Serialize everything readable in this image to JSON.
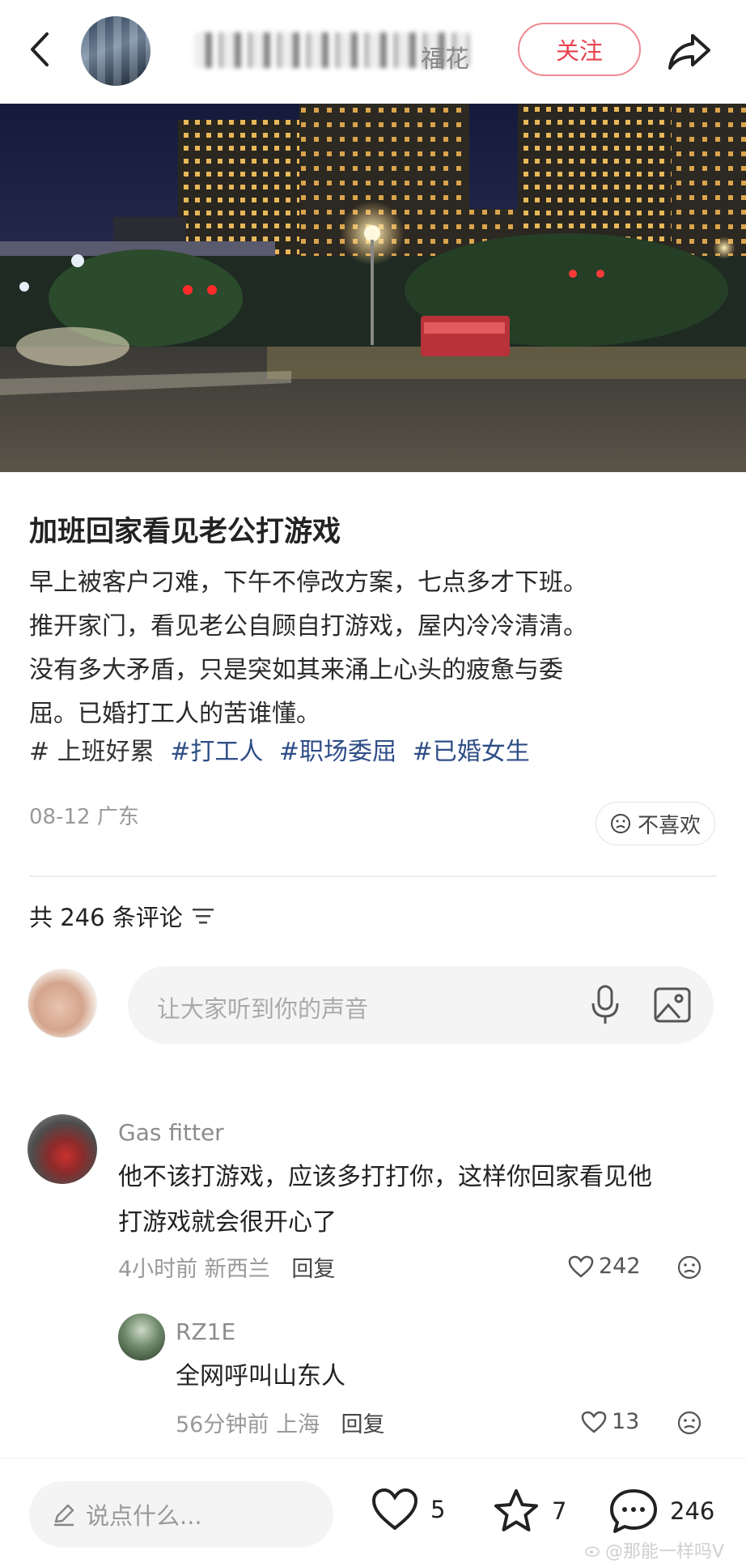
{
  "header": {
    "author_name_visible": "福花",
    "follow_label": "关注"
  },
  "post": {
    "title": "加班回家看见老公打游戏",
    "body_lines": [
      "早上被客户刁难，下午不停改方案，七点多才下班。",
      "推开家门，看见老公自顾自打游戏，屋内冷冷清清。",
      "没有多大矛盾，只是突如其来涌上心头的疲惫与委",
      "屈。已婚打工人的苦谁懂。"
    ],
    "tags": [
      "# 上班好累",
      "#打工人",
      "#职场委屈",
      "#已婚女生"
    ],
    "date": "08-12",
    "location": "广东",
    "dislike_label": "不喜欢"
  },
  "comments_section": {
    "count_label": "共 246 条评论",
    "input_placeholder": "让大家听到你的声音"
  },
  "comments": [
    {
      "user": "Gas fitter",
      "text_lines": [
        "他不该打游戏，应该多打打你，这样你回家看见他",
        "打游戏就会很开心了"
      ],
      "time": "4小时前",
      "location": "新西兰",
      "reply_label": "回复",
      "likes": "242"
    }
  ],
  "reply": {
    "user": "RZ1E",
    "text": "全网呼叫山东人",
    "time": "56分钟前",
    "location": "上海",
    "reply_label": "回复",
    "likes": "13"
  },
  "bottom": {
    "say_placeholder": "说点什么...",
    "likes": "5",
    "stars": "7",
    "comments": "246"
  },
  "watermark": "@那能一样吗V",
  "colors": {
    "follow_red": "#e8424f",
    "tag_blue": "#2f4e87"
  }
}
